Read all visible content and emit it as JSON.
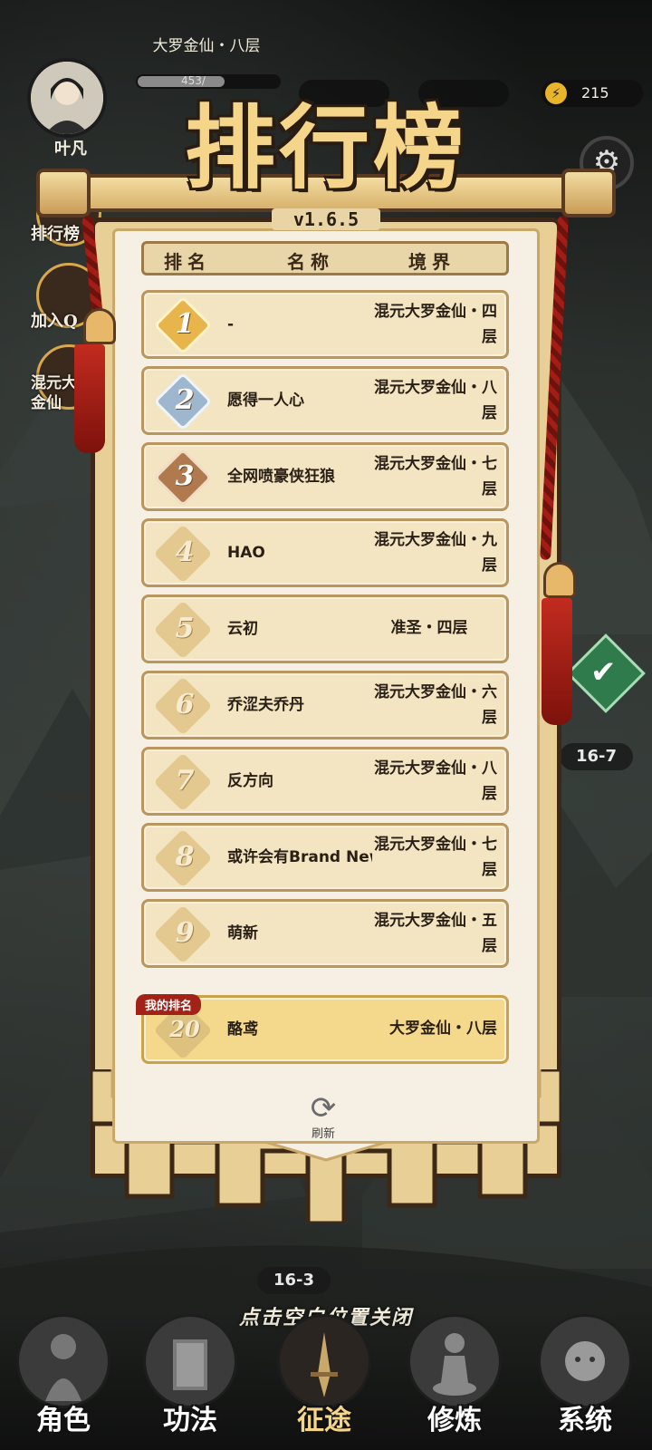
{
  "hud": {
    "player_name": "叶凡",
    "realm": "大罗金仙・八层",
    "exp_text": "453/",
    "exp_fraction": 0.6,
    "energy": "215"
  },
  "side_buttons": {
    "rank": "排行榜",
    "join_qq": "加入Q",
    "realm_badge": "混元大罗金仙"
  },
  "title": "排行榜",
  "version": "v1.6.5",
  "table": {
    "headers": [
      "排名",
      "名称",
      "境界"
    ],
    "rows": [
      {
        "rank": "1",
        "name": "-",
        "realm": "混元大罗金仙・四层"
      },
      {
        "rank": "2",
        "name": "愿得一人心",
        "realm": "混元大罗金仙・八层"
      },
      {
        "rank": "3",
        "name": "全网喷豪侠狂狼",
        "realm": "混元大罗金仙・七层"
      },
      {
        "rank": "4",
        "name": "HAO",
        "realm": "混元大罗金仙・九层"
      },
      {
        "rank": "5",
        "name": "云初",
        "realm": "准圣・四层"
      },
      {
        "rank": "6",
        "name": "乔涩夫乔丹",
        "realm": "混元大罗金仙・六层"
      },
      {
        "rank": "7",
        "name": "反方向",
        "realm": "混元大罗金仙・八层"
      },
      {
        "rank": "8",
        "name": "或许会有Brand New S",
        "realm": "混元大罗金仙・七层"
      },
      {
        "rank": "9",
        "name": "萌新",
        "realm": "混元大罗金仙・五层"
      }
    ],
    "mine": {
      "tag": "我的排名",
      "rank": "20",
      "name": "酪鸢",
      "realm": "大罗金仙・八层"
    }
  },
  "refresh_label": "刷新",
  "map": {
    "stage_a": "16-7",
    "stage_b": "16-3"
  },
  "close_hint": "点击空白位置关闭",
  "nav": [
    "角色",
    "功法",
    "征途",
    "修炼",
    "系统"
  ],
  "colors": {
    "gold_badge": "#e8b54c",
    "silver_badge": "#9fb6cf",
    "bronze_badge": "#b07a4e",
    "plain_badge": "#e3c98f",
    "banner": "#e8cf96",
    "row_bg": "#f3e4c2",
    "mine_row_bg": "#f4d98d",
    "mine_tag": "#a32218"
  }
}
